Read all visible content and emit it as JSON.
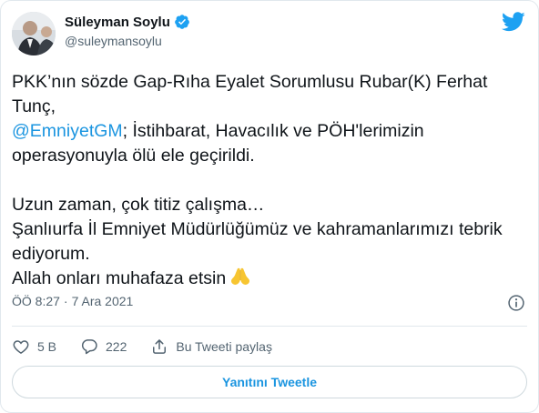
{
  "author": {
    "name": "Süleyman Soylu",
    "handle": "@suleymansoylu"
  },
  "tweet": {
    "line1": "PKK’nın sözde Gap-Rıha Eyalet Sorumlusu Rubar(K) Ferhat Tunç,",
    "mention": "@EmniyetGM",
    "line2_rest": "; İstihbarat, Havacılık ve PÖH'lerimizin operasyonuyla ölü ele geçirildi.",
    "para2": "Uzun zaman, çok titiz çalışma…\nŞanlıurfa İl Emniyet Müdürlüğümüz ve kahramanlarımızı tebrik ediyorum.\nAllah onları muhafaza etsin"
  },
  "meta": {
    "time": "ÖÖ 8:27",
    "separator": "·",
    "date": "7 Ara 2021"
  },
  "actions": {
    "likes": "5 B",
    "replies": "222",
    "share_label": "Bu Tweeti paylaş"
  },
  "reply_button": "Yanıtını Tweetle",
  "colors": {
    "accent": "#1b95e0",
    "like_red": "#e0245e",
    "text_secondary": "#536471",
    "border": "#e1e8ed"
  },
  "icons": [
    "avatar",
    "verified-badge-icon",
    "twitter-bird-icon",
    "info-icon",
    "heart-icon",
    "reply-bubble-icon",
    "share-icon",
    "folded-hands-emoji"
  ]
}
